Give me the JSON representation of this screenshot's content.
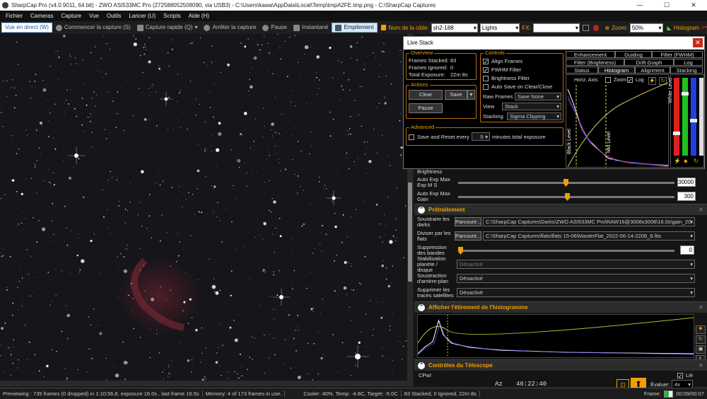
{
  "window": {
    "title": "SharpCap Pro (v4.0.9011, 64 bit) - ZWO ASI533MC Pro (272588052509090, via USB3) - C:\\Users\\kawa\\AppData\\Local\\Temp\\tmpA2FE.tmp.png - C:\\SharpCap Captures"
  },
  "menu": [
    "Fichier",
    "Cameras",
    "Capture",
    "Vue",
    "Outils",
    "Lancer (U)",
    "Scripts",
    "Aide (H)"
  ],
  "toolbar": {
    "live": "Vue en direct (W)",
    "start_capture": "Commencer la capture (S)",
    "quick_capture": "Capture rapide (Q)",
    "stop_capture": "Arrêter la capture",
    "pause": "Pause",
    "snapshot": "Instantané",
    "stack": "Empilement",
    "target_label": "Nom de la cible:",
    "target_value": "sh2-188",
    "frame_type": "Lights",
    "fx_label": "FX:",
    "zoom_label": "Zoom:",
    "zoom_value": "50%",
    "histogram": "Histogram"
  },
  "live_stack": {
    "title": "Live Stack",
    "overview_title": "Overview",
    "frames_stacked_label": "Frames Stacked:",
    "frames_stacked": "83",
    "frames_ignored_label": "Frames Ignored:",
    "frames_ignored": "0",
    "total_exposure_label": "Total Exposure:",
    "total_exposure": "22m 8s",
    "actions_title": "Actions",
    "clear": "Clear",
    "save": "Save",
    "pause": "Pause",
    "advanced_title": "Advanced",
    "save_reset_label": "Save and Reset every",
    "save_reset_value": "5",
    "save_reset_suffix": "minutes total exposure",
    "controls_title": "Controls",
    "align_frames": "Align Frames",
    "fwhm_filter": "FWHM Filter",
    "brightness_filter": "Brightness Filter",
    "auto_save": "Auto Save on Clear/Close",
    "raw_frames_label": "Raw Frames",
    "raw_frames_value": "Save None",
    "view_label": "View",
    "view_value": "Stack",
    "stacking_label": "Stacking",
    "stacking_value": "Sigma Clipping",
    "tabs_row1": [
      "Enhancement",
      "Guiding",
      "Filter (FWHM)"
    ],
    "tabs_row2": [
      "Filter (Brightness)",
      "Drift Graph",
      "Log"
    ],
    "tabs_row3": [
      "Status",
      "Histogram",
      "Alignment",
      "Stacking"
    ],
    "horiz_axis": "Horiz. Axis:",
    "zoom": "Zoom",
    "log": "Log",
    "black_level": "Black Level",
    "mid_level": "Mid Level",
    "white_level": "White Level"
  },
  "right_panel": {
    "brightness": "Brightness",
    "auto_exp_max": "Auto Exp Max Exp M S",
    "auto_exp_max_value": "30000",
    "auto_exp_gain": "Auto Exp Max Gain",
    "auto_exp_gain_value": "300",
    "preproc_title": "Prétraitement",
    "sub_darks": "Soustraire les darks",
    "browse": "Parcourir...",
    "darks_path": "C:\\SharpCap Captures\\Darks\\ZWO ASI533MC Pro\\RAW16@3008x3008\\16.0s\\gain_20...",
    "div_flats": "Diviser par les flats",
    "flats_path": "C:\\SharpCap Captures\\flats\\flats 15-06\\MasterFlat_2022-06-14-2208_8.fits",
    "band_supp": "Suppression des bandes",
    "band_value": "0",
    "stab": "Stabilisation planète / disque",
    "stab_value": "Désactivé",
    "bg_sub": "Soustraction d'arrière-plan",
    "bg_value": "Désactivé",
    "sat_sub": "Supprimer les traces satellites",
    "sat_value": "Désactivé",
    "hist_title": "Afficher l'étirement de l'histogramme",
    "tel_title": "Contrôles du Télescope",
    "tel_name": "CPwI",
    "az_label": "Az",
    "az_value": "46:22:40",
    "evaluer_label": "Évaluer:",
    "evaluer_value": "4x",
    "lie": "Lié"
  },
  "status": {
    "preview": "Previewing : 735 frames (0 dropped) in 1:10:56,8, exposure 16.0s , last frame 16.5s",
    "memory": "Memory: 4 of 173 frames in use.",
    "cooler": "Cooler: 40%, Temp: -4.8C, Target: -5.0C",
    "stack": "83 Stacked, 0 Ignored, 22m 8s",
    "frame_label": "Frame:",
    "frame_progress": 0.53,
    "time": "00:09/00:07"
  },
  "colors": {
    "accent": "#f0a000",
    "stack_bg": "#d6eaf8"
  }
}
